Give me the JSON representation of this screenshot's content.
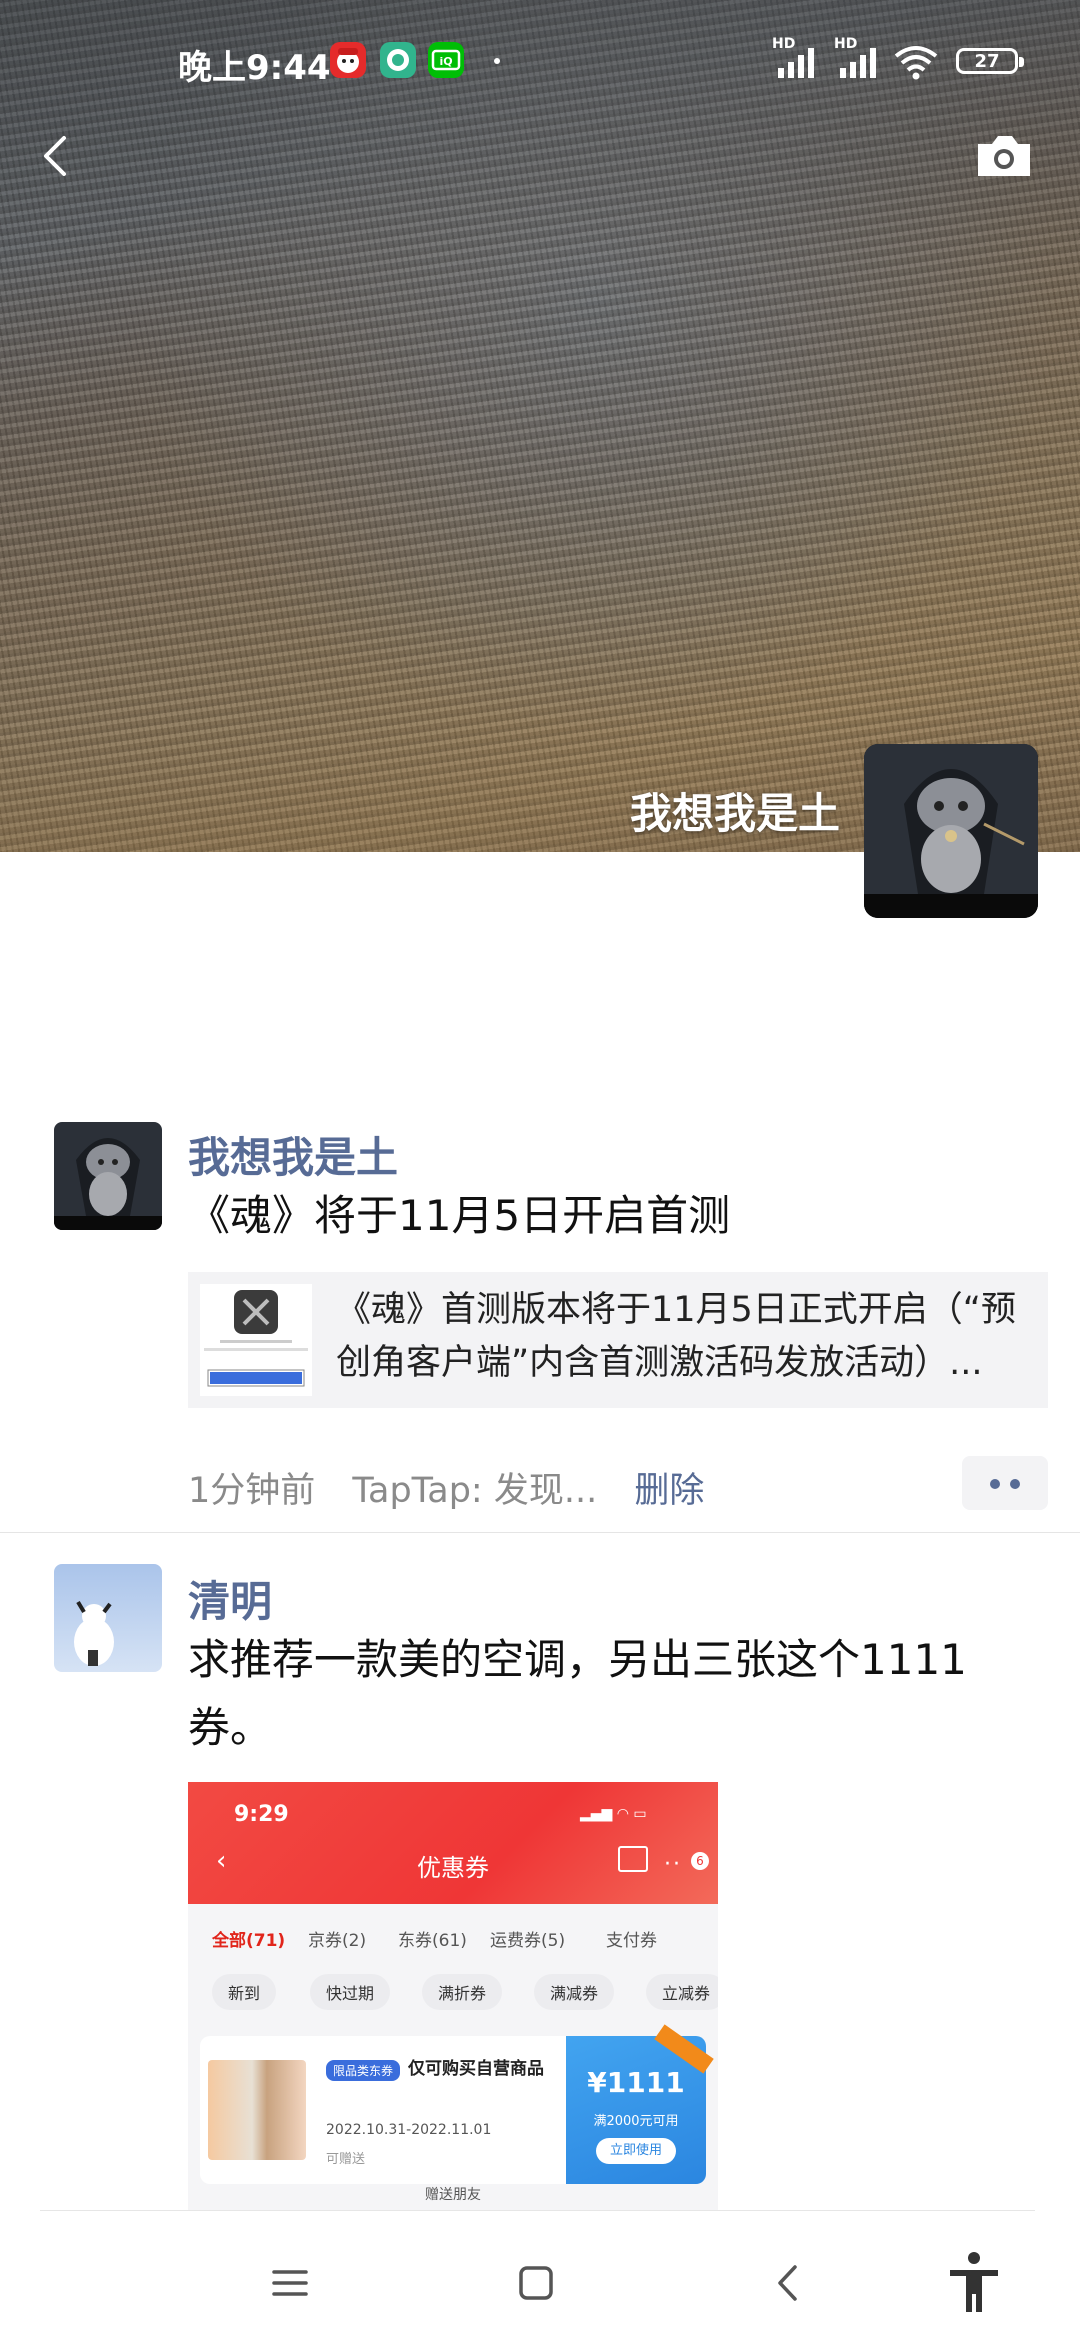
{
  "status_bar": {
    "time": "晚上9:44",
    "signal_label_1": "HD",
    "signal_label_2": "HD",
    "battery": "27"
  },
  "cover": {
    "username": "我想我是土"
  },
  "posts": [
    {
      "author": "我想我是土",
      "text": "《魂》将于11月5日开启首测",
      "link": {
        "text": "《魂》首测版本将于11月5日正式开启（“预创角客户端”内含首测激活码发放活动）..."
      },
      "time": "1分钟前",
      "source": "TapTap: 发现...",
      "delete_label": "删除"
    },
    {
      "author": "清明",
      "text": "求推荐一款美的空调，另出三张这个1111券。",
      "image": {
        "time": "9:29",
        "title": "优惠券",
        "tabs": [
          "全部(71)",
          "京券(2)",
          "东券(61)",
          "运费券(5)",
          "支付券"
        ],
        "chips": [
          "新到",
          "快过期",
          "满折券",
          "满减券",
          "立减券"
        ],
        "coupon": {
          "tag": "限品类东券",
          "name": "仅可购买自营商品",
          "dates": "2022.10.31-2022.11.01",
          "gift": "可赠送",
          "amount": "¥1111",
          "condition": "满2000元可用",
          "use": "立即使用"
        },
        "footer": "赠送朋友"
      }
    }
  ],
  "icons": {
    "back": "back-chevron-icon",
    "camera": "camera-icon",
    "more": "more-dots-icon",
    "nav_menu": "menu-icon",
    "nav_home": "home-square-icon",
    "nav_back": "nav-back-icon",
    "accessibility": "accessibility-icon"
  },
  "colors": {
    "link_blue": "#576b95",
    "meta_gray": "#8a8a8a",
    "card_bg": "#f3f3f5"
  }
}
